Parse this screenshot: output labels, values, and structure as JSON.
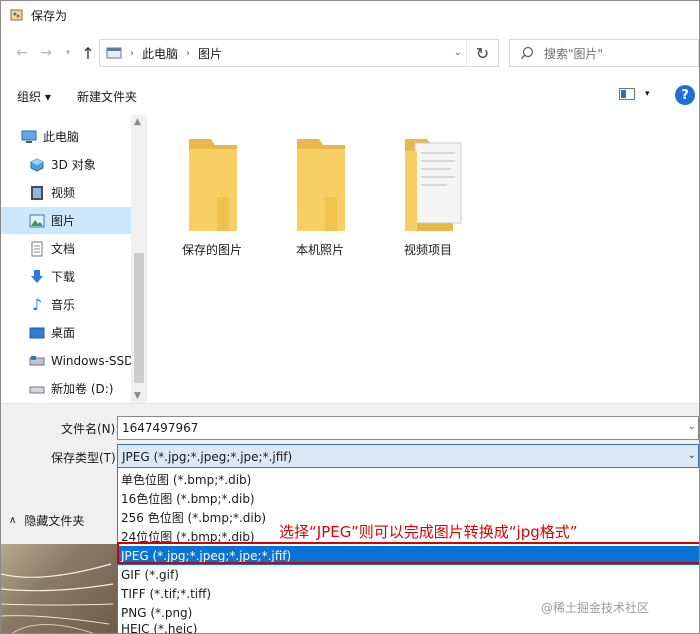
{
  "window": {
    "title": "保存为"
  },
  "address": {
    "crumbs": [
      "此电脑",
      "图片"
    ]
  },
  "search": {
    "placeholder": "搜索\"图片\""
  },
  "toolbar": {
    "organize_label": "组织 ▾",
    "newfolder_label": "新建文件夹",
    "help": "?"
  },
  "sidebar": {
    "items": [
      {
        "label": "此电脑",
        "icon": "computer-icon"
      },
      {
        "label": "3D 对象",
        "icon": "cube-icon"
      },
      {
        "label": "视频",
        "icon": "video-icon"
      },
      {
        "label": "图片",
        "icon": "picture-icon",
        "selected": true
      },
      {
        "label": "文档",
        "icon": "document-icon"
      },
      {
        "label": "下载",
        "icon": "download-icon"
      },
      {
        "label": "音乐",
        "icon": "music-icon"
      },
      {
        "label": "桌面",
        "icon": "desktop-icon"
      },
      {
        "label": "Windows-SSD (",
        "icon": "drive-icon"
      },
      {
        "label": "新加卷 (D:)",
        "icon": "drive-icon"
      }
    ]
  },
  "folders": [
    {
      "label": "保存的图片"
    },
    {
      "label": "本机照片"
    },
    {
      "label": "视频项目"
    }
  ],
  "form": {
    "filename_label": "文件名(N):",
    "filename_value": "1647497967",
    "filetype_label": "保存类型(T):",
    "filetype_value": "JPEG (*.jpg;*.jpeg;*.jpe;*.jfif)"
  },
  "hide_folders_label": "隐藏文件夹",
  "filetype_options": [
    "单色位图 (*.bmp;*.dib)",
    "16色位图 (*.bmp;*.dib)",
    "256 色位图 (*.bmp;*.dib)",
    "24位位图 (*.bmp;*.dib)",
    "JPEG (*.jpg;*.jpeg;*.jpe;*.jfif)",
    "GIF (*.gif)",
    "TIFF (*.tif;*.tiff)",
    "PNG (*.png)",
    "HEIC (*.heic)"
  ],
  "selected_option_index": 4,
  "annotation": "选择“JPEG”则可以完成图片转换成“jpg格式”",
  "watermark": "@稀土掘金技术社区",
  "colors": {
    "accent": "#0a73d6",
    "annotation": "#e00000",
    "folder": "#f5c652"
  }
}
